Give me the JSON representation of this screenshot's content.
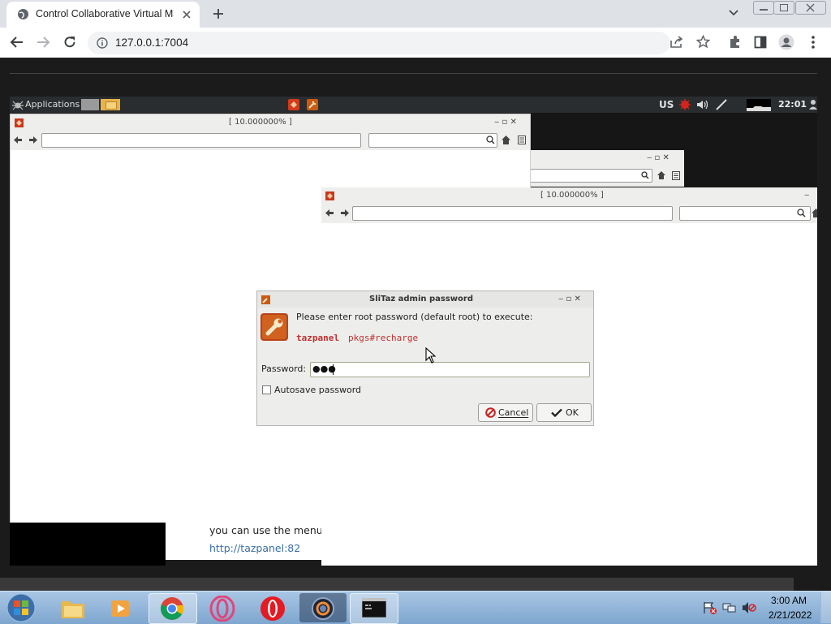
{
  "browser": {
    "tab_title": "Control Collaborative Virtual Ma",
    "url": "127.0.0.1:7004"
  },
  "desktop": {
    "panel": {
      "applications_label": "Applications",
      "keyboard_layout": "US",
      "clock": "22:01"
    },
    "window_back": {
      "title": "[ 10.000000% ]"
    },
    "window_front": {
      "title": "[ 10.000000% ]"
    },
    "page_text": {
      "menu_line": "you can use the menu",
      "link": "http://tazpanel:82"
    }
  },
  "dialog": {
    "title": "SliTaz admin password",
    "prompt": "Please enter root password (default root) to execute:",
    "command_name": "tazpanel",
    "command_arg": "pkgs#recharge",
    "password_label": "Password:",
    "password_value": "●●●",
    "autosave_label": "Autosave password",
    "cancel_label": "Cancel",
    "ok_label": "OK"
  },
  "taskbar": {
    "time": "3:00 AM",
    "date": "2/21/2022"
  }
}
